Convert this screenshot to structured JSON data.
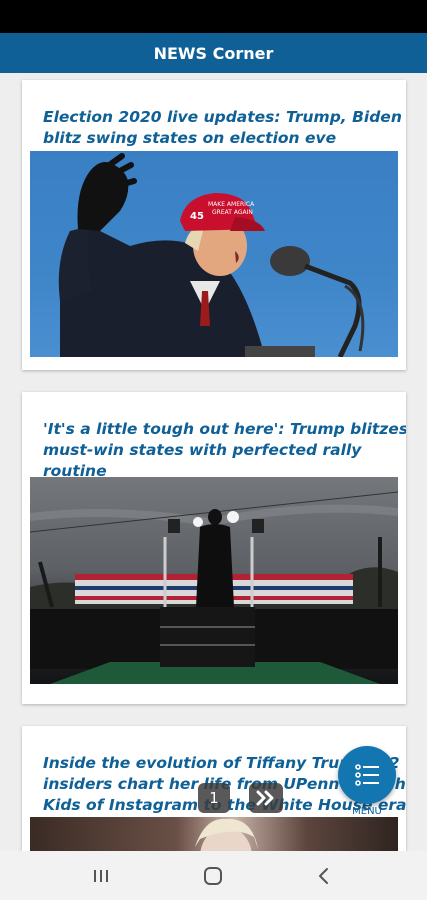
{
  "app": {
    "title": "NEWS Corner"
  },
  "articles": [
    {
      "title": "Election 2020 live updates: Trump, Biden\nblitz swing states on election eve",
      "image": "trump-speaking-rally-photo"
    },
    {
      "title": "'It's a little tough out here': Trump blitzes\nmust-win states with perfected rally\nroutine",
      "image": "rally-stage-photo"
    },
    {
      "title": "Inside the evolution of Tiffany Trump: 12\ninsiders chart her life from UPenn to Rich\nKids of Instagram to the White House era",
      "image": "tiffany-trump-photo"
    }
  ],
  "pager": {
    "current_page": "1",
    "next_icon": "double-chevron-right-icon"
  },
  "fab": {
    "label": "MENU",
    "icon": "list-menu-icon"
  },
  "nav": {
    "recent_icon": "recent-apps-icon",
    "home_icon": "home-icon",
    "back_icon": "back-icon"
  },
  "colors": {
    "app_bar": "#0f6096",
    "title_text": "#0f6096",
    "fab": "#1376b0"
  }
}
